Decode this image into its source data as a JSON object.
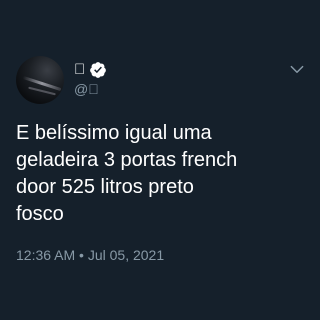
{
  "tweet": {
    "display_name": "\u0000",
    "handle": "@\u0000",
    "text": "E belíssimo igual uma\ngeladeira 3 portas french\ndoor 525 litros preto\nfosco",
    "time": "12:36 AM",
    "separator": "•",
    "date": "Jul 05, 2021"
  },
  "icons": {
    "verified": "verified-badge-icon",
    "menu": "chevron-down-icon"
  },
  "colors": {
    "background": "#15202b",
    "text": "#ffffff",
    "secondary_text": "#8899a6"
  }
}
